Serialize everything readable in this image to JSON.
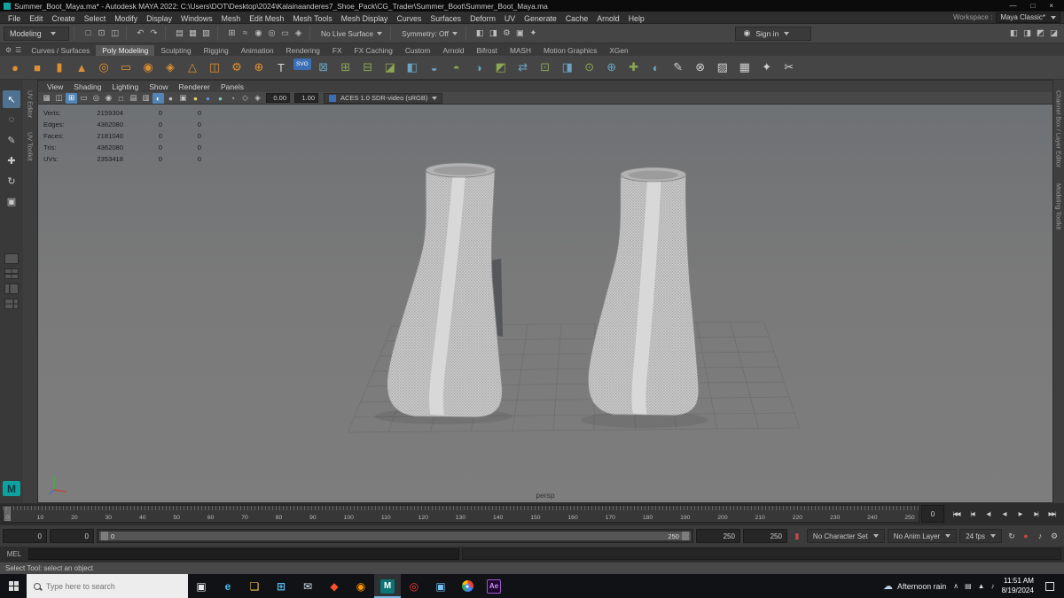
{
  "window": {
    "title": "Summer_Boot_Maya.ma* - Autodesk MAYA 2022: C:\\Users\\DOT\\Desktop\\2024\\Kalainaanderes7_Shoe_Pack\\CG_Trader\\Summer_Boot\\Summer_Boot_Maya.ma",
    "minimize": "—",
    "maximize": "□",
    "close": "×"
  },
  "menubar": {
    "items": [
      "File",
      "Edit",
      "Create",
      "Select",
      "Modify",
      "Display",
      "Windows",
      "Mesh",
      "Edit Mesh",
      "Mesh Tools",
      "Mesh Display",
      "Curves",
      "Surfaces",
      "Deform",
      "UV",
      "Generate",
      "Cache",
      "Arnold",
      "Help"
    ],
    "workspace_label": "Workspace :",
    "workspace_value": "Maya Classic*"
  },
  "toolbar": {
    "mode": "Modeling",
    "file_icons": [
      {
        "n": "new-scene-icon",
        "g": "□"
      },
      {
        "n": "open-scene-icon",
        "g": "⊡"
      },
      {
        "n": "save-scene-icon",
        "g": "◫"
      }
    ],
    "history_icons": [
      {
        "n": "undo-icon",
        "g": "↶"
      },
      {
        "n": "redo-icon",
        "g": "↷"
      }
    ],
    "select_icons": [
      {
        "n": "select-hierarchy-icon",
        "g": "▤"
      },
      {
        "n": "select-object-icon",
        "g": "▦"
      },
      {
        "n": "select-component-icon",
        "g": "▧"
      }
    ],
    "snap_icons": [
      {
        "n": "snap-grid-icon",
        "g": "⊞"
      },
      {
        "n": "snap-curve-icon",
        "g": "≈"
      },
      {
        "n": "snap-point-icon",
        "g": "◉"
      },
      {
        "n": "snap-projection-icon",
        "g": "◎"
      },
      {
        "n": "snap-viewplane-icon",
        "g": "▭"
      },
      {
        "n": "make-live-icon",
        "g": "◈"
      }
    ],
    "live_surface": "No Live Surface",
    "symmetry": "Symmetry: Off",
    "render_icons": [
      {
        "n": "render-frame-icon",
        "g": "◧"
      },
      {
        "n": "ipr-render-icon",
        "g": "◨"
      },
      {
        "n": "render-settings-icon",
        "g": "⚙"
      },
      {
        "n": "hypershade-icon",
        "g": "▣"
      },
      {
        "n": "light-editor-icon",
        "g": "✦"
      }
    ],
    "signin": "Sign in",
    "panel_icons": [
      {
        "n": "single-pane-layout-icon",
        "g": "◧"
      },
      {
        "n": "channel-box-toggle-icon",
        "g": "◨"
      },
      {
        "n": "attribute-editor-toggle-icon",
        "g": "◩"
      },
      {
        "n": "tool-settings-toggle-icon",
        "g": "◪"
      }
    ]
  },
  "shelf": {
    "gear": "⚙",
    "menu": "☰",
    "tabs": [
      {
        "label": "Curves / Surfaces"
      },
      {
        "label": "Poly Modeling",
        "cls": "active"
      },
      {
        "label": "Sculpting"
      },
      {
        "label": "Rigging"
      },
      {
        "label": "Animation"
      },
      {
        "label": "Rendering"
      },
      {
        "label": "FX"
      },
      {
        "label": "FX Caching"
      },
      {
        "label": "Custom"
      },
      {
        "label": "Arnold"
      },
      {
        "label": "Bifrost"
      },
      {
        "label": "MASH"
      },
      {
        "label": "Motion Graphics"
      },
      {
        "label": "XGen"
      }
    ],
    "icons": [
      {
        "n": "poly-sphere-icon",
        "g": "●",
        "c": "#dd9033"
      },
      {
        "n": "poly-cube-icon",
        "g": "■",
        "c": "#dd9033"
      },
      {
        "n": "poly-cylinder-icon",
        "g": "▮",
        "c": "#dd9033"
      },
      {
        "n": "poly-cone-icon",
        "g": "▲",
        "c": "#dd9033"
      },
      {
        "n": "poly-torus-icon",
        "g": "◎",
        "c": "#dd9033"
      },
      {
        "n": "poly-plane-icon",
        "g": "▭",
        "c": "#dd9033"
      },
      {
        "n": "poly-disc-icon",
        "g": "◉",
        "c": "#dd9033"
      },
      {
        "n": "poly-platonic-icon",
        "g": "◈",
        "c": "#dd9033"
      },
      {
        "n": "poly-pyramid-icon",
        "g": "△",
        "c": "#dd9033"
      },
      {
        "n": "poly-pipe-icon",
        "g": "◫",
        "c": "#dd9033"
      },
      {
        "n": "poly-gear-icon",
        "g": "⚙",
        "c": "#dd9033"
      },
      {
        "n": "poly-soccer-icon",
        "g": "⊕",
        "c": "#dd9033"
      },
      {
        "n": "poly-text-icon",
        "g": "T",
        "c": "#d8d8d8"
      },
      {
        "n": "poly-svg-icon",
        "g": "SVG",
        "c": "#ffffff",
        "cls": "svgbadge"
      },
      {
        "n": "boolean-icon",
        "g": "⊠",
        "c": "#6aa4c0"
      },
      {
        "n": "combine-icon",
        "g": "⊞",
        "c": "#8ca655"
      },
      {
        "n": "separate-icon",
        "g": "⊟",
        "c": "#8ca655"
      },
      {
        "n": "extract-icon",
        "g": "◪",
        "c": "#8ca655"
      },
      {
        "n": "fill-hole-icon",
        "g": "◧",
        "c": "#6aa4c0"
      },
      {
        "n": "reduce-icon",
        "g": "◒",
        "c": "#6aa4c0"
      },
      {
        "n": "smooth-icon",
        "g": "◓",
        "c": "#8ca655"
      },
      {
        "n": "append-icon",
        "g": "◑",
        "c": "#6aa4c0"
      },
      {
        "n": "bevel-icon",
        "g": "◩",
        "c": "#8ca655"
      },
      {
        "n": "bridge-icon",
        "g": "⇄",
        "c": "#6aa4c0"
      },
      {
        "n": "connect-icon",
        "g": "⊡",
        "c": "#8ca655"
      },
      {
        "n": "detach-icon",
        "g": "◨",
        "c": "#6aa4c0"
      },
      {
        "n": "extrude-icon",
        "g": "⊙",
        "c": "#8ca655"
      },
      {
        "n": "merge-icon",
        "g": "⊕",
        "c": "#6aa4c0"
      },
      {
        "n": "transform-icon",
        "g": "✚",
        "c": "#8ca655"
      },
      {
        "n": "mirror-icon",
        "g": "◐",
        "c": "#6aa4c0"
      },
      {
        "n": "multi-cut-icon",
        "g": "✎",
        "c": "#cfcfcf"
      },
      {
        "n": "target-weld-icon",
        "g": "⊗",
        "c": "#cfcfcf"
      },
      {
        "n": "crease-icon",
        "g": "▨",
        "c": "#cfcfcf"
      },
      {
        "n": "quad-draw-icon",
        "g": "▦",
        "c": "#cfcfcf"
      },
      {
        "n": "sculpt-icon",
        "g": "✦",
        "c": "#cfcfcf"
      },
      {
        "n": "scissors-icon",
        "g": "✂",
        "c": "#cfcfcf"
      }
    ]
  },
  "toolbox": {
    "tools": [
      {
        "n": "select-tool",
        "g": "↖",
        "cls": "active"
      },
      {
        "n": "lasso-tool",
        "g": "◌"
      },
      {
        "n": "paint-select-tool",
        "g": "✎"
      },
      {
        "n": "move-tool",
        "g": "✚"
      },
      {
        "n": "rotate-tool",
        "g": "↻"
      },
      {
        "n": "scale-tool",
        "g": "▣"
      }
    ],
    "layouts": [
      {
        "n": "layout-single-button",
        "cls": "l1"
      },
      {
        "n": "layout-four-pane-button",
        "cls": "l4"
      },
      {
        "n": "layout-two-pane-button",
        "cls": "l2"
      },
      {
        "n": "layout-persp-outliner-button",
        "cls": "l3"
      }
    ],
    "logo": "M"
  },
  "left_strip": {
    "labels": [
      "UV Editor",
      "UV Toolkit"
    ]
  },
  "right_strip": {
    "labels": [
      "Channel Box / Layer Editor",
      "Modeling Toolkit"
    ]
  },
  "viewport": {
    "menu": [
      "View",
      "Shading",
      "Lighting",
      "Show",
      "Renderer",
      "Panels"
    ],
    "icons": [
      {
        "n": "camera-attributes-icon",
        "g": "▦"
      },
      {
        "n": "pan-zoom-icon",
        "g": "◫"
      },
      {
        "n": "grid-toggle-icon",
        "g": "⊞",
        "cls": "on"
      },
      {
        "n": "film-gate-icon",
        "g": "▭"
      },
      {
        "n": "resolution-gate-icon",
        "g": "◎"
      },
      {
        "n": "gate-mask-icon",
        "g": "◉"
      },
      {
        "n": "field-chart-icon",
        "g": "□"
      },
      {
        "n": "safe-action-icon",
        "g": "▤"
      },
      {
        "n": "safe-title-icon",
        "g": "▥"
      },
      {
        "n": "wireframe-icon",
        "g": "◐",
        "cls": "on"
      },
      {
        "n": "shaded-icon",
        "g": "●"
      },
      {
        "n": "textured-icon",
        "g": "▣"
      },
      {
        "n": "lights-icon",
        "g": "●",
        "c": "#e8d06a"
      },
      {
        "n": "shadows-icon",
        "g": "●",
        "c": "#5a8fd0"
      },
      {
        "n": "ao-icon",
        "g": "●",
        "c": "#7ec8b8"
      },
      {
        "n": "motion-blur-icon",
        "g": "◔"
      },
      {
        "n": "xray-icon",
        "g": "◇"
      },
      {
        "n": "isolate-select-icon",
        "g": "◈"
      }
    ],
    "exposure": "0.00",
    "gamma": "1.00",
    "colorspace": "ACES 1.0 SDR-video (sRGB)",
    "camera_label": "persp",
    "hud": [
      {
        "label": "Verts:",
        "value": "2159304",
        "c1": "0",
        "c2": "0"
      },
      {
        "label": "Edges:",
        "value": "4362080",
        "c1": "0",
        "c2": "0"
      },
      {
        "label": "Faces:",
        "value": "2181040",
        "c1": "0",
        "c2": "0"
      },
      {
        "label": "Tris:",
        "value": "4362080",
        "c1": "0",
        "c2": "0"
      },
      {
        "label": "UVs:",
        "value": "2353418",
        "c1": "0",
        "c2": "0"
      }
    ]
  },
  "timeline": {
    "ticks": [
      "0",
      "10",
      "20",
      "30",
      "40",
      "50",
      "60",
      "70",
      "80",
      "90",
      "100",
      "110",
      "120",
      "130",
      "140",
      "150",
      "160",
      "170",
      "180",
      "190",
      "200",
      "210",
      "220",
      "230",
      "240",
      "250"
    ],
    "current": "0",
    "buttons": [
      {
        "n": "go-to-start-button",
        "g": "|◀◀"
      },
      {
        "n": "step-back-key-button",
        "g": "|◀"
      },
      {
        "n": "step-back-frame-button",
        "g": "◀|"
      },
      {
        "n": "play-backwards-button",
        "g": "◀"
      },
      {
        "n": "play-forward-button",
        "g": "▶"
      },
      {
        "n": "step-forward-frame-button",
        "g": "▶|"
      },
      {
        "n": "go-to-end-button",
        "g": "▶▶|"
      }
    ]
  },
  "range": {
    "anim_start": "0",
    "play_start": "0",
    "slider_start": "0",
    "slider_end": "250",
    "play_end": "250",
    "anim_end": "250",
    "character_set": "No Character Set",
    "anim_layer": "No Anim Layer",
    "fps": "24 fps",
    "icons": [
      {
        "n": "time-bookmark-icon",
        "g": "▮",
        "c": "#c84a42"
      }
    ],
    "right_icons": [
      {
        "n": "playback-options-icon",
        "g": "↻"
      },
      {
        "n": "auto-key-icon",
        "g": "●",
        "c": "#cf4040"
      },
      {
        "n": "mute-audio-icon",
        "g": "♪"
      },
      {
        "n": "animation-preferences-icon",
        "g": "⚙"
      }
    ]
  },
  "command_line": {
    "label": "MEL",
    "value": "",
    "result": ""
  },
  "help_line": {
    "text": "Select Tool: select an object"
  },
  "taskbar": {
    "search_placeholder": "Type here to search",
    "apps": [
      {
        "n": "task-view-button",
        "g": "▣",
        "c": "#e8e8e8"
      },
      {
        "n": "edge-icon",
        "g": "e",
        "c": "#45c0f0"
      },
      {
        "n": "file-explorer-icon",
        "g": "❏",
        "c": "#f2c14b"
      },
      {
        "n": "store-icon",
        "g": "⊞",
        "c": "#58b7e8"
      },
      {
        "n": "mail-icon",
        "g": "✉",
        "c": "#d7e8f5"
      },
      {
        "n": "brave-icon",
        "g": "◆",
        "c": "#fb542b"
      },
      {
        "n": "firefox-icon",
        "g": "◉",
        "c": "#ff9500"
      },
      {
        "n": "maya-icon",
        "g": "M",
        "c": "#ffffff",
        "cls": "active"
      },
      {
        "n": "opera-icon",
        "g": "◎",
        "c": "#ff3b30"
      },
      {
        "n": "photos-icon",
        "g": "▣",
        "c": "#79c0f2"
      },
      {
        "n": "chrome-icon",
        "g": "",
        "cls": "chrome"
      },
      {
        "n": "after-effects-icon",
        "g": "Ae",
        "c": "#cf96fd",
        "cls": "aebox"
      }
    ],
    "weather": {
      "glyph": "☁",
      "label": "Afternoon rain"
    },
    "tray": [
      {
        "n": "hidden-icons-chevron",
        "g": "∧"
      },
      {
        "n": "system-tray-icon",
        "g": "▤"
      },
      {
        "n": "network-icon",
        "g": "▲"
      },
      {
        "n": "volume-icon",
        "g": "♪"
      }
    ],
    "clock": {
      "time": "11:51 AM",
      "date": "8/19/2024"
    }
  }
}
